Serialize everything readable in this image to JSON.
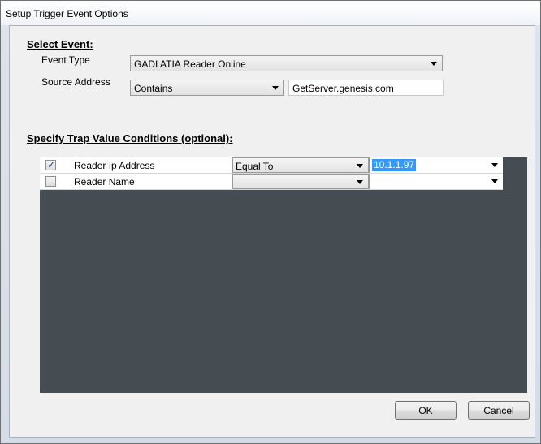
{
  "window": {
    "title": "Setup Trigger Event Options"
  },
  "select_event": {
    "heading": "Select Event:",
    "event_type_label": "Event Type",
    "event_type_value": "GADI ATIA Reader Online",
    "source_address_label": "Source Address",
    "source_address_operator": "Contains",
    "source_address_value": "GetServer.genesis.com"
  },
  "trap_conditions": {
    "heading": "Specify Trap Value Conditions (optional):",
    "rows": [
      {
        "checked": true,
        "check_glyph": "✓",
        "name": "Reader Ip Address",
        "operator": "Equal To",
        "value": "10.1.1.97"
      },
      {
        "checked": false,
        "check_glyph": "",
        "name": "Reader Name",
        "operator": "",
        "value": ""
      }
    ]
  },
  "buttons": {
    "ok": "OK",
    "cancel": "Cancel"
  },
  "colors": {
    "grid_background": "#454d52",
    "selection": "#3399ff"
  }
}
